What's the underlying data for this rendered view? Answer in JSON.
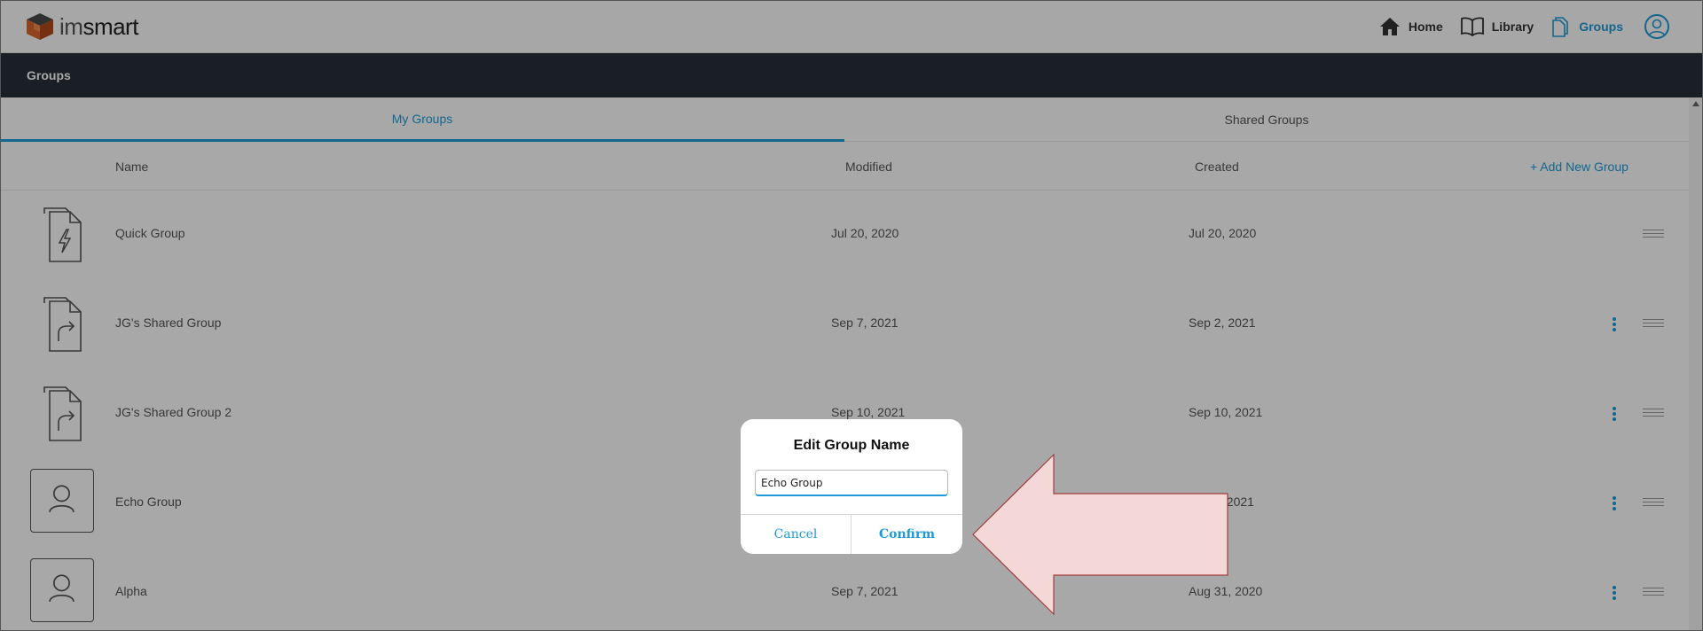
{
  "app": {
    "brand_prefix": "im",
    "brand_suffix": "smart"
  },
  "nav": {
    "home": "Home",
    "library": "Library",
    "groups": "Groups",
    "active": "Groups"
  },
  "page_title": "Groups",
  "tabs": [
    {
      "label": "My Groups",
      "active": true
    },
    {
      "label": "Shared Groups",
      "active": false
    }
  ],
  "table": {
    "headers": {
      "name": "Name",
      "modified": "Modified",
      "created": "Created"
    },
    "add_label": "+ Add New Group",
    "rows": [
      {
        "name": "Quick Group",
        "modified": "Jul 20, 2020",
        "created": "Jul 20, 2020",
        "icon": "quick-group-icon",
        "has_menu": false
      },
      {
        "name": "JG's Shared Group",
        "modified": "Sep 7, 2021",
        "created": "Sep 2, 2021",
        "icon": "shared-group-icon",
        "has_menu": true
      },
      {
        "name": "JG's Shared Group 2",
        "modified": "Sep 10, 2021",
        "created": "Sep 10, 2021",
        "icon": "shared-group-icon",
        "has_menu": true
      },
      {
        "name": "Echo Group",
        "modified": "",
        "created": ", 2021",
        "icon": "person-icon",
        "has_menu": true
      },
      {
        "name": "Alpha",
        "modified": "Sep 7, 2021",
        "created": "Aug 31, 2020",
        "icon": "person-icon",
        "has_menu": true
      }
    ]
  },
  "dialog": {
    "title": "Edit Group Name",
    "input_value": "Echo Group",
    "cancel_label": "Cancel",
    "confirm_label": "Confirm"
  },
  "colors": {
    "accent": "#1e9bd7",
    "titlebar": "#283039",
    "arrow_fill": "#f4d8d8",
    "arrow_stroke": "#a03c3c"
  }
}
